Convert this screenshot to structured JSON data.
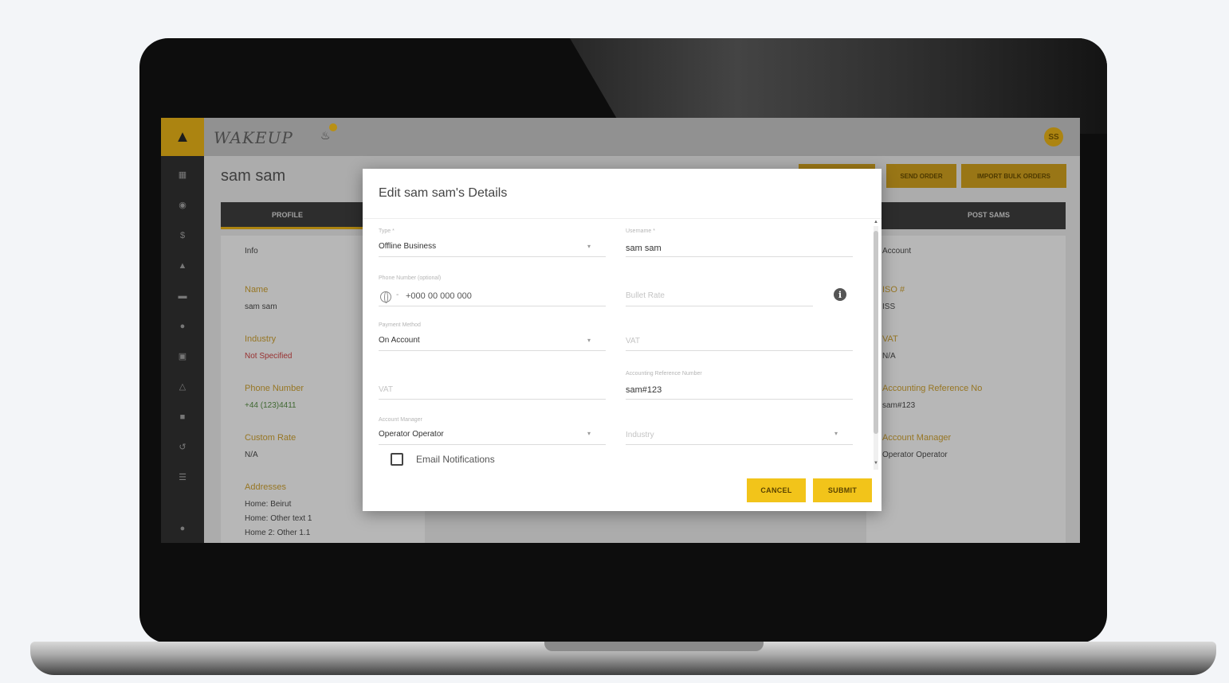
{
  "app": {
    "brand": "WAKEUP",
    "avatar_initials": "SS",
    "page_title": "sam sam"
  },
  "header_buttons": [
    "",
    "SEND ORDER",
    "IMPORT BULK ORDERS"
  ],
  "tabs": [
    "PROFILE",
    "POST SAMS"
  ],
  "sidebar_icons": [
    "home-icon",
    "dashboard-icon",
    "pin-icon",
    "dollar-icon",
    "truck-icon",
    "chat-icon",
    "location-icon",
    "calendar-icon",
    "network-icon",
    "box-icon",
    "history-icon",
    "list-icon",
    "support-icon"
  ],
  "background": {
    "left_card": {
      "section": "Info",
      "fields": [
        {
          "label": "Name",
          "value": "sam sam",
          "tone": "normal"
        },
        {
          "label": "Industry",
          "value": "Not Specified",
          "tone": "red"
        },
        {
          "label": "Phone Number",
          "value": "+44 (123)4411",
          "tone": "green"
        },
        {
          "label": "Custom Rate",
          "value": "N/A",
          "tone": "normal"
        },
        {
          "label": "Addresses",
          "value": "Home: Beirut",
          "tone": "normal"
        }
      ],
      "extra_lines": [
        "Home: Other text 1",
        "Home 2: Other 1.1"
      ]
    },
    "right_card": {
      "section": "Account",
      "fields": [
        {
          "label": "ISO #",
          "value": "ISS"
        },
        {
          "label": "VAT",
          "value": "N/A"
        },
        {
          "label": "Accounting Reference No",
          "value": "sam#123"
        },
        {
          "label": "Account Manager",
          "value": "Operator Operator"
        }
      ]
    }
  },
  "modal": {
    "title": "Edit sam sam's Details",
    "fields": {
      "type": {
        "label": "Type *",
        "value": "Offline Business"
      },
      "username": {
        "label": "Username *",
        "value": "sam sam"
      },
      "phone": {
        "label": "Phone Number (optional)",
        "value": "+000 00 000 000"
      },
      "bullet_rate": {
        "placeholder": "Bullet Rate"
      },
      "payment_method": {
        "label": "Payment Method",
        "value": "On Account"
      },
      "vat_right": {
        "placeholder": "VAT"
      },
      "vat_left": {
        "placeholder": "VAT"
      },
      "accounting_ref": {
        "label": "Accounting Reference Number",
        "value": "sam#123"
      },
      "account_manager": {
        "label": "Account Manager",
        "value": "Operator Operator"
      },
      "industry": {
        "placeholder": "Industry"
      }
    },
    "email_notifications_label": "Email Notifications",
    "email_notifications_checked": false,
    "cancel_label": "CANCEL",
    "submit_label": "SUBMIT"
  },
  "colors": {
    "accent": "#f2c41a",
    "accent_dim": "#c99a14",
    "sidebar": "#2b2b2b"
  }
}
